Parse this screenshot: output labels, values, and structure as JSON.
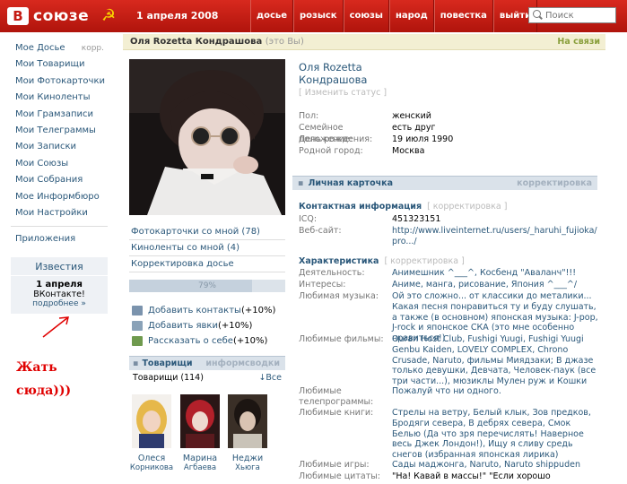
{
  "header": {
    "logo_letter": "В",
    "logo_text": "союзе",
    "emblem": "☭",
    "date": "1 апреля 2008",
    "nav": [
      "досье",
      "розыск",
      "союзы",
      "народ",
      "повестка",
      "выйти"
    ],
    "search_placeholder": "Поиск"
  },
  "sidebar": {
    "items": [
      {
        "label": "Мое Досье",
        "extra": "корр."
      },
      {
        "label": "Мои Товарищи"
      },
      {
        "label": "Мои Фотокарточки"
      },
      {
        "label": "Мои Киноленты"
      },
      {
        "label": "Мои Грамзаписи"
      },
      {
        "label": "Мои Телеграммы"
      },
      {
        "label": "Мои Записки"
      },
      {
        "label": "Мои Союзы"
      },
      {
        "label": "Мои Собрания"
      },
      {
        "label": "Мое Информбюро"
      },
      {
        "label": "Мои Настройки"
      }
    ],
    "apps": "Приложения",
    "news": {
      "title": "Известия",
      "date": "1 апреля",
      "text": "ВКонтакте!",
      "more": "подробнее »"
    },
    "scrawl_line1": "Жать",
    "scrawl_line2": "сюда)))"
  },
  "profile_bar": {
    "name": "Оля Rozetta Кондрашова",
    "you": "(это Вы)",
    "status": "На связи"
  },
  "photo_menu": {
    "links": [
      "Фотокарточки со мной (78)",
      "Киноленты со мной (4)",
      "Корректировка досье"
    ],
    "progress_label": "79%",
    "progress_value": 0.79
  },
  "actions": [
    {
      "link": "Добавить контакты",
      "bonus": " (+10%)",
      "color": "#7b93ad"
    },
    {
      "link": "Добавить явки",
      "bonus": " (+10%)",
      "color": "#8aa2b8"
    },
    {
      "link": "Рассказать о себе",
      "bonus": " (+10%)",
      "color": "#6f9a4e"
    }
  ],
  "friends": {
    "title": "Товарищи",
    "inform": "информсводки",
    "count": "Товарищи (114)",
    "all": "↓Все",
    "list": [
      {
        "first": "Олеся",
        "last": "Корникова"
      },
      {
        "first": "Марина",
        "last": "Агбаева"
      },
      {
        "first": "Неджи",
        "last": "Хьюга"
      }
    ]
  },
  "info": {
    "name_line1": "Оля Rozetta",
    "name_line2": "Кондрашова",
    "status_link": "[ Изменить статус ]",
    "basic": [
      {
        "k": "Пол:",
        "v": "женский"
      },
      {
        "k": "Семейное положение:",
        "v": "есть друг"
      },
      {
        "k": "День рождения:",
        "v": "19 июля 1990"
      },
      {
        "k": "Родной город:",
        "v": "Москва"
      }
    ],
    "card_title": "Личная карточка",
    "card_edit": "корректировка",
    "contact_title": "Контактная информация",
    "contact_edit": "[ корректировка ]",
    "icq_k": "ICQ:",
    "icq_v": "451323151",
    "site_k": "Веб-сайт:",
    "site_v": "http://www.liveinternet.ru/users/_haruhi_fujioka/pro.../",
    "char_title": "Характеристика",
    "char_edit": "[ корректировка ]",
    "rows": [
      {
        "k": "Деятельность:",
        "v": "Анимешник ^___^, Косбенд \"Аваланч\"!!!"
      },
      {
        "k": "Интересы:",
        "v": "Аниме, манга, рисование, Япония ^___^/"
      },
      {
        "k": "Любимая музыка:",
        "v": "Ой это сложно... от классики до металики... Какая песня понравиться ту и буду слушать, а также (в основном) японская музыка: J-pop, J-rock и японское СКА (это мне особенно нравиться!)"
      },
      {
        "k": "Любимые фильмы:",
        "v": "Ouran Host Club, Fushigi Yuugi, Fushigi Yuugi Genbu Kaiden, LOVELY COMPLEX, Chrono Crusade, Naruto, фильмы Миядзаки; В джазе только девушки, Девчата, Человек-паук (все три части...), мюзиклы Мулен руж и Кошки"
      },
      {
        "k": "Любимые телепрограммы:",
        "v": "Пожалуй что ни одного."
      },
      {
        "k": "Любимые книги:",
        "v": "Стрелы на ветру, Белый клык, Зов предков, Бродяги севера, В дебрях севера, Смок Белью (Да что зря перечислять! Наверное весь Джек Лондон!), Ищу я сливу средь снегов (избранная японская лирика)"
      },
      {
        "k": "Любимые игры:",
        "v": "Сады маджонга, Naruto, Naruto shippuden"
      },
      {
        "k": "Любимые цитаты:",
        "v": "\"На! Кавай в массы!\" \"Если хорошо поплакать,"
      }
    ]
  },
  "colors": {
    "header_red": "#c41a12",
    "link_blue": "#2b587a",
    "scrawl_red": "#e00000",
    "online_green": "#8a9f3c"
  }
}
